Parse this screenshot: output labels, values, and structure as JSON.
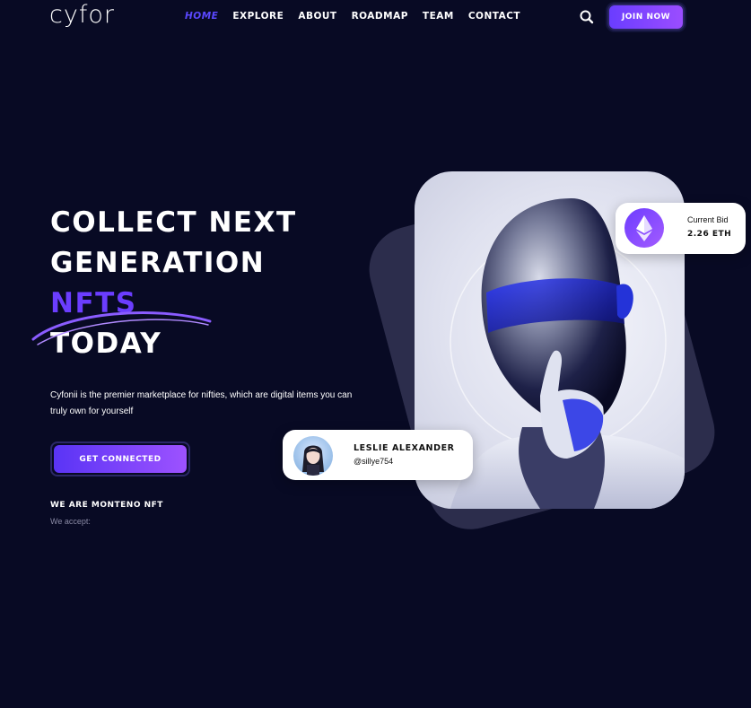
{
  "header": {
    "logo": "cyfor",
    "nav": [
      {
        "label": "Home",
        "active": true
      },
      {
        "label": "Explore",
        "active": false
      },
      {
        "label": "About",
        "active": false
      },
      {
        "label": "Roadmap",
        "active": false
      },
      {
        "label": "Team",
        "active": false
      },
      {
        "label": "Contact",
        "active": false
      }
    ],
    "search_icon": "search-icon",
    "join_label": "Join Now"
  },
  "hero": {
    "title_line1": "Collect Next",
    "title_line2": "Generation",
    "title_accent": "NFTs",
    "title_line4": "Today",
    "description": "Cyfonii is the premier marketplace for nifties, which are digital items you can truly own for yourself",
    "cta_label": "Get Connected",
    "tagline": "We are Monteno NFT",
    "accept_label": "We accept:"
  },
  "bid_card": {
    "icon": "ethereum-icon",
    "label": "Current Bid",
    "value": "2.26 ETH"
  },
  "user_card": {
    "name": "Leslie Alexander",
    "handle": "@sillye754"
  },
  "colors": {
    "background": "#080a24",
    "accent": "#6b3dff",
    "button_gradient_start": "#5a34f5",
    "button_gradient_end": "#9d52ff"
  }
}
